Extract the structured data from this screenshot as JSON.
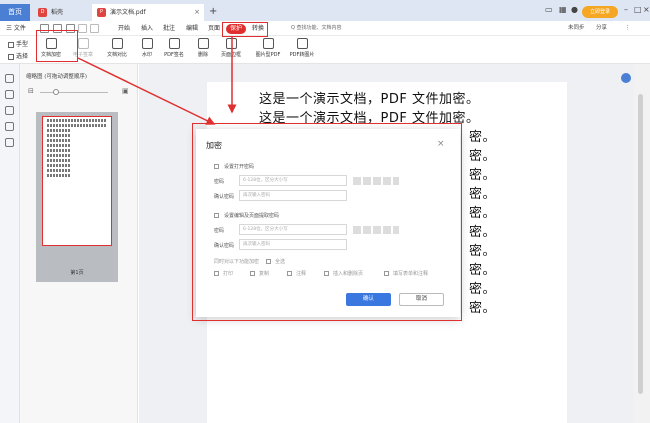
{
  "tabs": {
    "home": "首页",
    "app": "稻壳",
    "doc": "演示文档.pdf",
    "add": "+"
  },
  "window": {
    "login": "立即登录"
  },
  "menubar": {
    "file": "三 文件",
    "start": "开始",
    "insert": "插入",
    "comment": "批注",
    "edit": "编辑",
    "page": "页面",
    "protect": "保护",
    "convert": "转换",
    "search": "Q 查找功能、文档内容",
    "unsynced": "未同步",
    "share": "分享"
  },
  "toolbar": {
    "hand": "手型",
    "select": "选择",
    "doc_encrypt": "文档加密",
    "e_sign": "电子签章",
    "doc_compare": "文档对比",
    "watermark": "水印",
    "pdf_sign": "PDF签名",
    "redact": "删除",
    "page_border": "页面边框",
    "img_to_pdf": "图片型PDF",
    "pdf_to_img": "PDF转图片"
  },
  "thumbpanel": {
    "title": "缩略图 (可拖动调整顺序)",
    "page_label": "第1页"
  },
  "document": {
    "lines": [
      "这是一个演示文档，PDF 文件加密。",
      "这是一个演示文档，PDF 文件加密。",
      "密。",
      "密。",
      "密。",
      "密。",
      "密。",
      "密。",
      "密。",
      "密。",
      "密。",
      "密。"
    ]
  },
  "dialog": {
    "title": "加密",
    "open_pwd_check": "设置打开密码",
    "pwd_label": "密码",
    "pwd_placeholder": "6-128位，区分大小写",
    "confirm_label": "确认密码",
    "confirm_placeholder": "再次输入密码",
    "edit_pwd_check": "设置编辑及页面提取密码",
    "pwd2_placeholder": "6-128位，区分大小写",
    "confirm2_placeholder": "再次输入密码",
    "allow_title": "同时对以下功能加密",
    "all_select": "全选",
    "opt_print": "打印",
    "opt_copy": "复制",
    "opt_annot": "注释",
    "opt_insert_delete": "插入和删除页",
    "opt_fill_form": "填写表单和注释",
    "ok": "确认",
    "cancel": "取消"
  },
  "colors": {
    "accent": "#3a78e0",
    "annotation": "#e02f2f",
    "protect_tab": "#e02f2f"
  }
}
